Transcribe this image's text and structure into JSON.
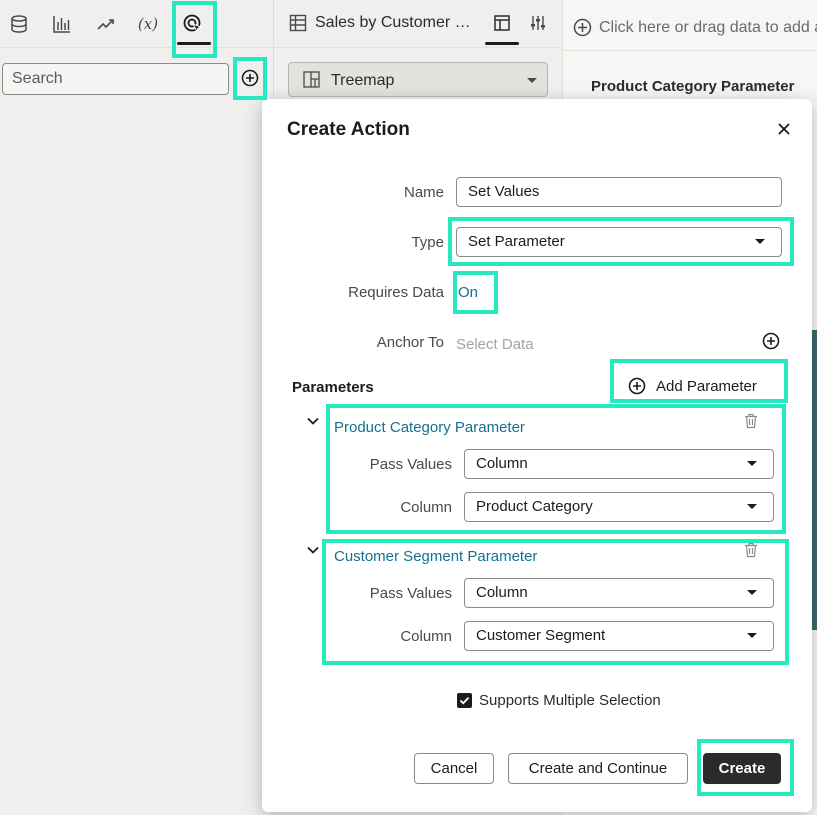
{
  "left_panel": {
    "toolbar_icons": [
      "database-icon",
      "bar-chart-icon",
      "trend-icon",
      "variable-icon",
      "action-icon"
    ],
    "math_icon_label": "(x)",
    "search_placeholder": "Search"
  },
  "middle_panel": {
    "canvas_tab_title": "Sales by Customer Segment",
    "viz_type": "Treemap"
  },
  "right_panel": {
    "drop_hint": "Click here or drag data to add a",
    "canvas_title": "Product Category Parameter"
  },
  "dialog": {
    "title": "Create Action",
    "fields": {
      "name_label": "Name",
      "name_value": "Set Values",
      "type_label": "Type",
      "type_value": "Set Parameter",
      "requires_data_label": "Requires Data",
      "requires_data_value": "On",
      "anchor_label": "Anchor To",
      "anchor_placeholder": "Select Data"
    },
    "parameters_title": "Parameters",
    "add_parameter_label": "Add Parameter",
    "parameters": [
      {
        "title": "Product Category Parameter",
        "pass_values_label": "Pass Values",
        "pass_values": "Column",
        "column_label": "Column",
        "column": "Product Category"
      },
      {
        "title": "Customer Segment Parameter",
        "pass_values_label": "Pass Values",
        "pass_values": "Column",
        "column_label": "Column",
        "column": "Customer Segment"
      }
    ],
    "supports_multiple_selection": "Supports Multiple Selection",
    "buttons": {
      "cancel": "Cancel",
      "create_continue": "Create and Continue",
      "create": "Create"
    }
  },
  "colors": {
    "highlight": "#27e8bf",
    "link": "#13708f",
    "primary_button": "#2b2b2b"
  }
}
